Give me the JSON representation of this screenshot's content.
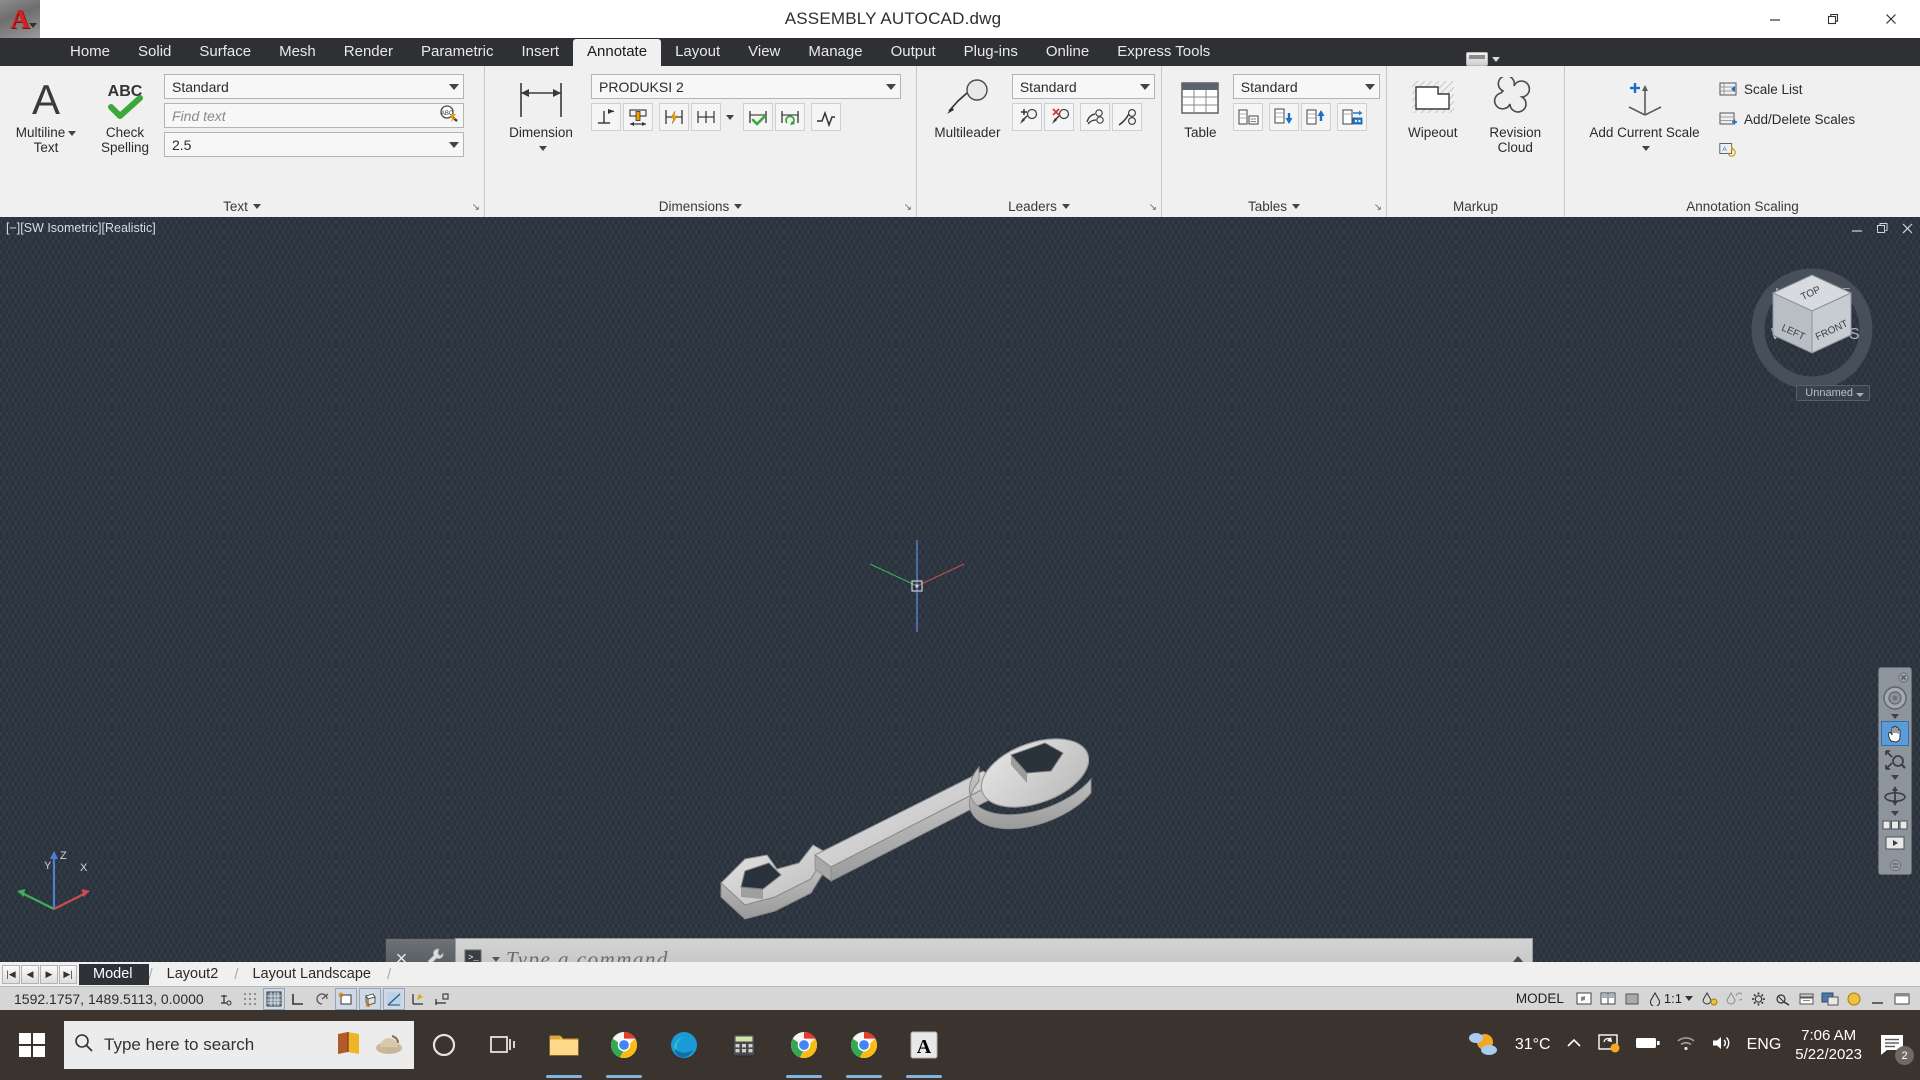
{
  "window": {
    "title": "ASSEMBLY AUTOCAD.dwg",
    "logo_letter": "A",
    "minimize_label": "Minimize",
    "restore_label": "Restore",
    "close_label": "Close"
  },
  "ribbon": {
    "tabs": [
      {
        "label": "Home",
        "active": false
      },
      {
        "label": "Solid",
        "active": false
      },
      {
        "label": "Surface",
        "active": false
      },
      {
        "label": "Mesh",
        "active": false
      },
      {
        "label": "Render",
        "active": false
      },
      {
        "label": "Parametric",
        "active": false
      },
      {
        "label": "Insert",
        "active": false
      },
      {
        "label": "Annotate",
        "active": true
      },
      {
        "label": "Layout",
        "active": false
      },
      {
        "label": "View",
        "active": false
      },
      {
        "label": "Manage",
        "active": false
      },
      {
        "label": "Output",
        "active": false
      },
      {
        "label": "Plug-ins",
        "active": false
      },
      {
        "label": "Online",
        "active": false
      },
      {
        "label": "Express Tools",
        "active": false
      }
    ],
    "panels": {
      "text": {
        "title": "Text",
        "multiline_text": "Multiline\nText",
        "multiline_text_line1": "Multiline",
        "multiline_text_line2": "Text",
        "check_spelling_line1": "Check",
        "check_spelling_line2": "Spelling",
        "style_value": "Standard",
        "find_placeholder": "Find text",
        "height_value": "2.5"
      },
      "dimensions": {
        "title": "Dimensions",
        "dimension_label": "Dimension",
        "style_value": "PRODUKSI 2"
      },
      "leaders": {
        "title": "Leaders",
        "multileader_label": "Multileader",
        "style_value": "Standard"
      },
      "tables": {
        "title": "Tables",
        "table_label": "Table",
        "style_value": "Standard"
      },
      "markup": {
        "title": "Markup",
        "wipeout_label": "Wipeout",
        "revision_cloud_line1": "Revision",
        "revision_cloud_line2": "Cloud"
      },
      "annotation_scaling": {
        "title": "Annotation Scaling",
        "add_current_scale_line1": "Add Current Scale",
        "scale_list_label": "Scale List",
        "add_delete_scales_label": "Add/Delete Scales"
      }
    }
  },
  "viewport": {
    "label": "[−][SW Isometric][Realistic]",
    "viewcube": {
      "top": "TOP",
      "left": "LEFT",
      "front": "FRONT",
      "north": "N",
      "east": "E",
      "south": "S",
      "west": "W",
      "view_name": "Unnamed"
    },
    "ucs": {
      "x": "X",
      "y": "Y",
      "z": "Z"
    },
    "background_color": "#2a323c",
    "model_description": "3D shaded open-end wrench (spanner) in SW isometric view"
  },
  "command_line": {
    "placeholder": "Type  a  command",
    "close_label": "×",
    "wrench_label": "customize"
  },
  "layout_tabs": {
    "first_label": "|◀",
    "prev_label": "◀",
    "next_label": "▶",
    "last_label": "▶|",
    "tabs": [
      {
        "label": "Model",
        "active": true
      },
      {
        "label": "Layout2",
        "active": false
      },
      {
        "label": "Layout Landscape",
        "active": false
      }
    ]
  },
  "status_bar": {
    "coordinates": "1592.1757, 1489.5113, 0.0000",
    "model_label": "MODEL",
    "scale_value": "1:1",
    "toggles": [
      {
        "name": "infer-constraints",
        "on": false
      },
      {
        "name": "snap-mode",
        "on": false
      },
      {
        "name": "grid-display",
        "on": true
      },
      {
        "name": "ortho-mode",
        "on": false
      },
      {
        "name": "polar-tracking",
        "on": false
      },
      {
        "name": "object-snap",
        "on": true
      },
      {
        "name": "3d-object-snap",
        "on": false
      },
      {
        "name": "object-snap-tracking",
        "on": true
      },
      {
        "name": "dynamic-ucs",
        "on": false
      },
      {
        "name": "dynamic-input",
        "on": false
      }
    ]
  },
  "taskbar": {
    "search_placeholder": "Type here to search",
    "temperature": "31°C",
    "language": "ENG",
    "time": "7:06 AM",
    "date": "5/22/2023",
    "notification_count": "2",
    "apps": [
      {
        "name": "cortana",
        "running": false
      },
      {
        "name": "task-view",
        "running": false
      },
      {
        "name": "file-explorer",
        "running": true
      },
      {
        "name": "chrome",
        "running": true
      },
      {
        "name": "edge",
        "running": false
      },
      {
        "name": "calculator",
        "running": false
      },
      {
        "name": "chrome-2",
        "running": true
      },
      {
        "name": "chrome-3",
        "running": true
      },
      {
        "name": "autocad",
        "running": true
      }
    ]
  }
}
